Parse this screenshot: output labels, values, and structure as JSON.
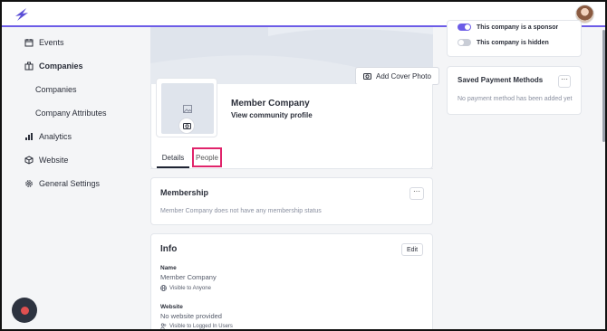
{
  "sidebar": {
    "items": [
      {
        "label": "Events",
        "icon": "calendar-icon"
      },
      {
        "label": "Companies",
        "icon": "building-icon"
      },
      {
        "label": "Companies",
        "icon": ""
      },
      {
        "label": "Company Attributes",
        "icon": ""
      },
      {
        "label": "Analytics",
        "icon": "bar-chart-icon"
      },
      {
        "label": "Website",
        "icon": "cube-icon"
      },
      {
        "label": "General Settings",
        "icon": "gear-icon"
      }
    ]
  },
  "profile": {
    "add_cover_label": "Add Cover Photo",
    "company_name": "Member Company",
    "community_link": "View community profile"
  },
  "tabs": [
    {
      "label": "Details"
    },
    {
      "label": "People"
    }
  ],
  "membership": {
    "title": "Membership",
    "more_label": "···",
    "empty_text": "Member Company does not have any membership status"
  },
  "info": {
    "title": "Info",
    "edit_label": "Edit",
    "fields": [
      {
        "label": "Name",
        "value": "Member Company",
        "visibility": "Visible to Anyone"
      },
      {
        "label": "Website",
        "value": "No website provided",
        "visibility": "Visible to Logged In Users"
      }
    ]
  },
  "settings": {
    "sponsor_label": "This company is a sponsor",
    "hidden_label": "This company is hidden"
  },
  "payment": {
    "title": "Saved Payment Methods",
    "more_label": "···",
    "empty_text": "No payment method has been added yet"
  },
  "colors": {
    "accent": "#6c5ce7",
    "highlight": "#e0246b"
  }
}
